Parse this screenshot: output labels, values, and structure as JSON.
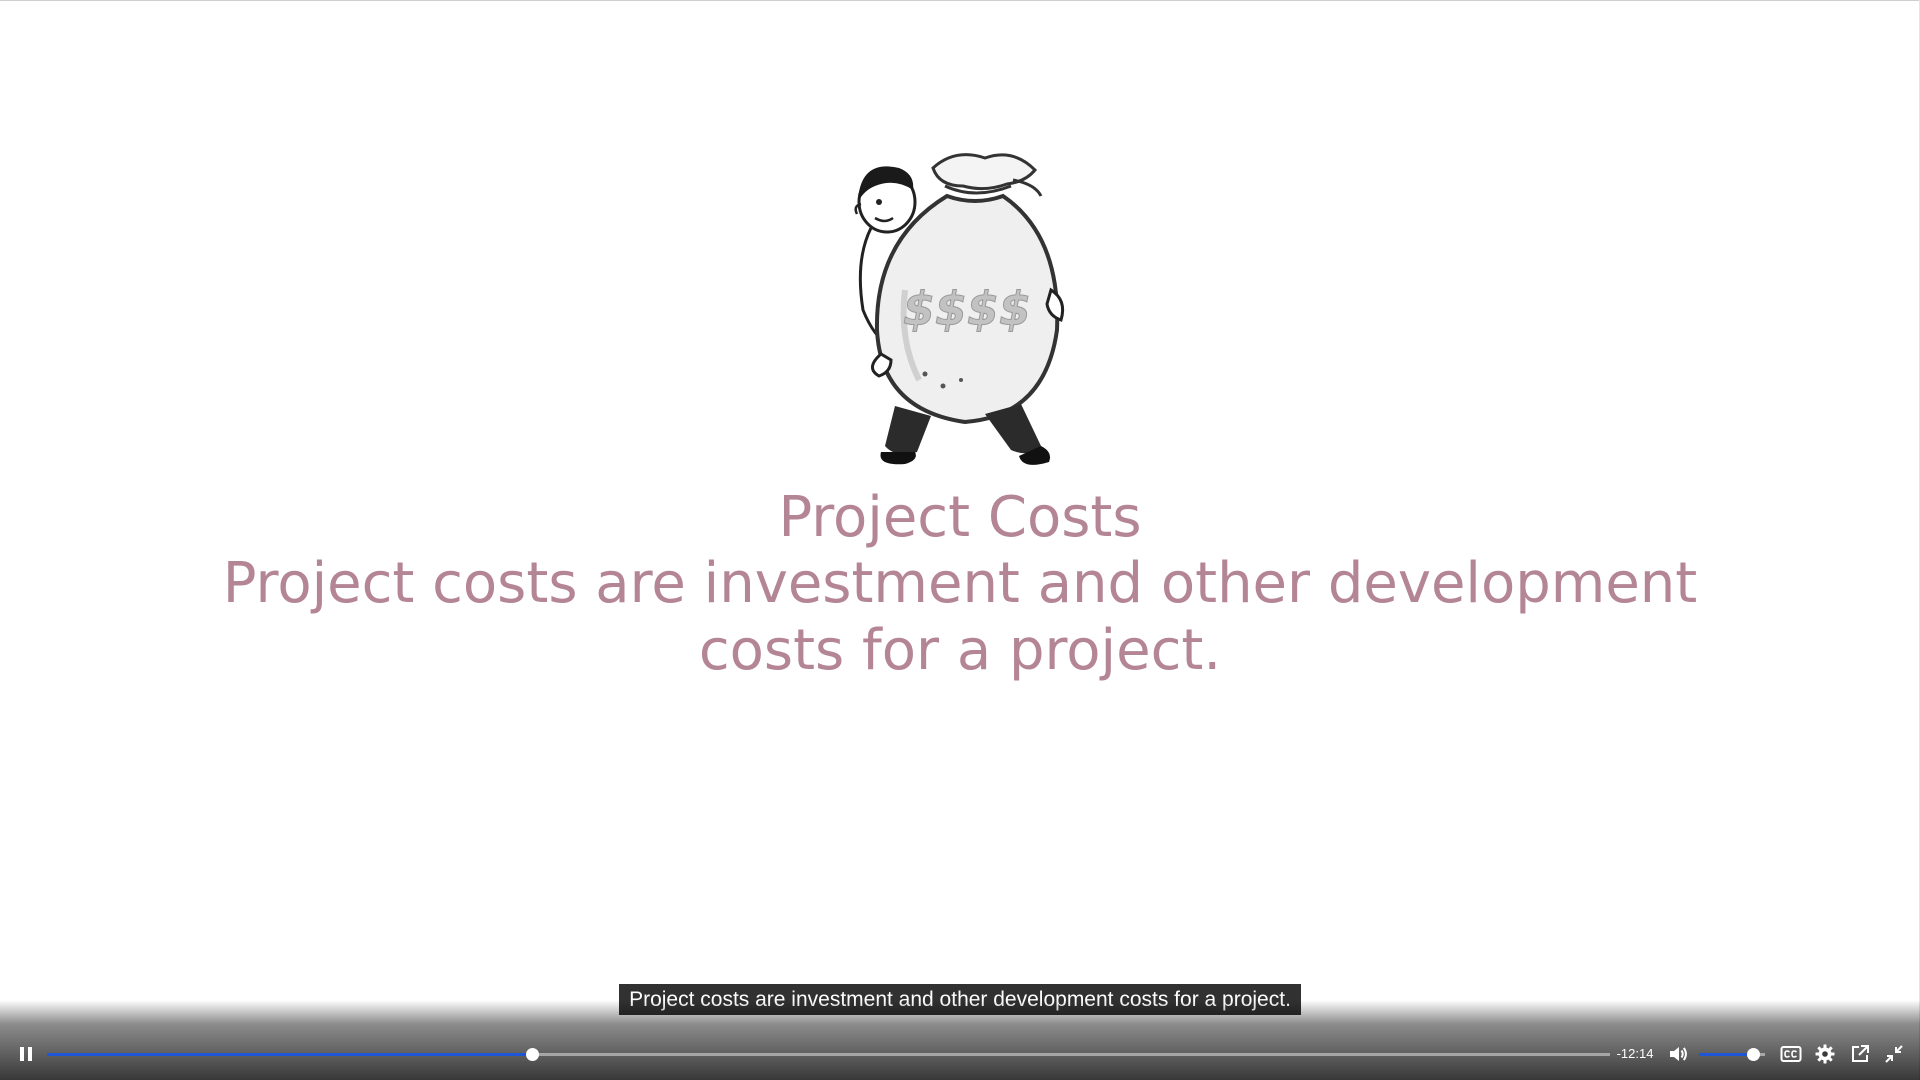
{
  "slide": {
    "bag_label": "$$$$",
    "title": "Project Costs",
    "body": "Project costs are investment and other development costs for a project."
  },
  "captions": {
    "text": "Project costs are investment and other development costs for a project."
  },
  "player": {
    "time_remaining": "-12:14",
    "progress_played": 0.31,
    "progress_buffered": 0.29,
    "volume": 0.82,
    "is_playing": true,
    "colors": {
      "played": "#1e56d6",
      "buffered": "#27a745",
      "slide_text": "#b48595"
    },
    "icons": {
      "play": "pause-icon",
      "mute": "volume-icon",
      "captions": "closed-captions-icon",
      "settings": "gear-icon",
      "popout": "popout-icon",
      "fullscreen": "exit-fullscreen-icon"
    }
  }
}
